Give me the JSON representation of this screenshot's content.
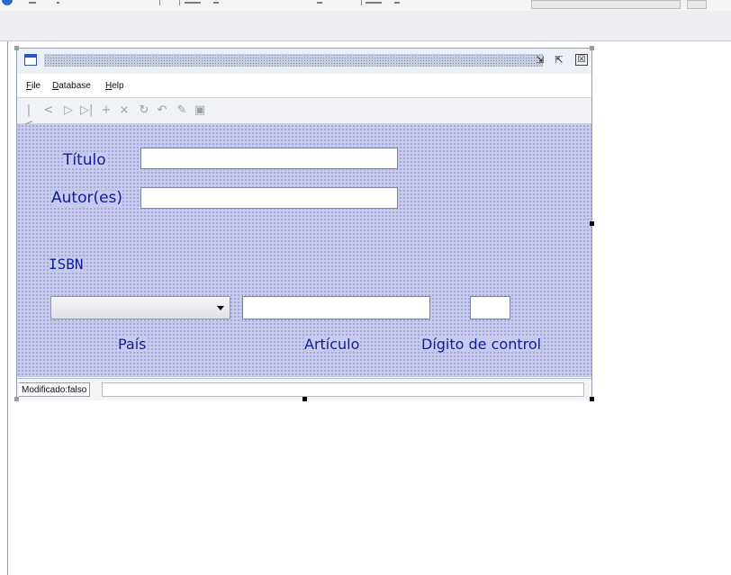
{
  "window": {
    "buttons": [
      "⇲",
      "⇱",
      "☒"
    ]
  },
  "menu": {
    "file": {
      "mnemonic": "F",
      "rest": "ile"
    },
    "database": {
      "mnemonic": "D",
      "rest": "atabase"
    },
    "help": {
      "mnemonic": "H",
      "rest": "elp"
    }
  },
  "navigator": {
    "icons": [
      "first-record-icon",
      "previous-record-icon",
      "next-record-icon",
      "last-record-icon",
      "insert-record-icon",
      "delete-record-icon",
      "refresh-icon",
      "cancel-icon",
      "commit-icon",
      "sql-icon"
    ],
    "glyphs": [
      "|<",
      "<",
      "▷",
      "▷|",
      "+",
      "×",
      "↻",
      "↶",
      "✎",
      "▣"
    ]
  },
  "form": {
    "titulo_label": "Título",
    "titulo_value": "",
    "autores_label": "Autor(es)",
    "autores_value": "",
    "isbn_label": "ISBN",
    "pais_value": "",
    "pais_label": "País",
    "articulo_value": "",
    "articulo_label": "Artículo",
    "digito_value": "",
    "digito_label": "Dígito de control"
  },
  "status": {
    "modified": "Modificado:falso"
  },
  "colors": {
    "label_text": "#0b1f96",
    "canvas_bg": "#c8c9ee"
  }
}
